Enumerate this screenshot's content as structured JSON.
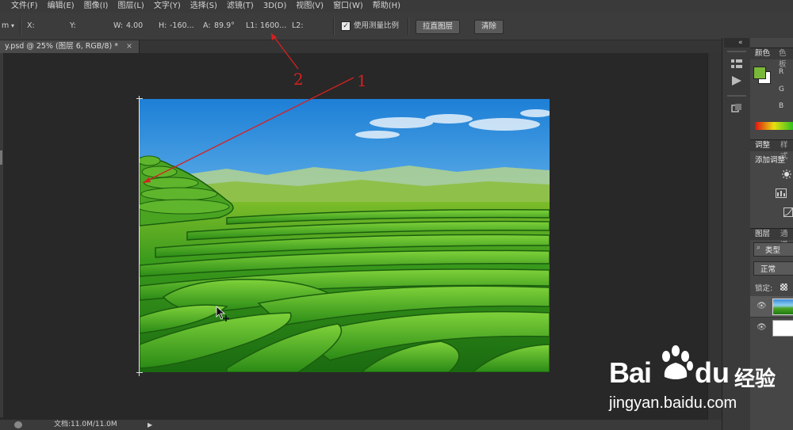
{
  "menu": [
    "文件(F)",
    "编辑(E)",
    "图像(I)",
    "图层(L)",
    "文字(Y)",
    "选择(S)",
    "滤镜(T)",
    "3D(D)",
    "视图(V)",
    "窗口(W)",
    "帮助(H)"
  ],
  "options": {
    "tool_icon": "ruler-tool-icon",
    "tool_glyph": "m",
    "dropdown_glyph": "▾",
    "x_label": "X:",
    "y_label": "Y:",
    "w_label": "W:",
    "w_value": "4.00",
    "h_label": "H:",
    "h_value": "-160...",
    "a_label": "A:",
    "a_value": "89.9°",
    "l1_label": "L1:",
    "l1_value": "1600...",
    "l2_label": "L2:",
    "checkbox_mark": "✓",
    "use_scale_label": "使用测量比例",
    "straighten_button": "拉直图层",
    "clear_button": "清除"
  },
  "document": {
    "tab_title": "y.psd @ 25% (图层 6, RGB/8) *",
    "close_glyph": "×"
  },
  "status": {
    "doc_info": "文档:11.0M/11.0M",
    "arrow": "▶"
  },
  "annotations": {
    "label_1": "1",
    "label_2": "2",
    "color": "#d62020"
  },
  "right_panel": {
    "collapse_glyph": "«",
    "color_tab": "颜色",
    "swatch_tab": "色板",
    "r": "R",
    "g": "G",
    "b": "B",
    "foreground_color": "#7ab83a",
    "background_color": "#ffffff",
    "adjust_tab": "调整",
    "style_tab": "样式",
    "add_adjust": "添加调整",
    "layers_tab": "图层",
    "channels_tab": "通道",
    "kind_filter": "类型",
    "blend_mode": "正常",
    "lock_label": "锁定:"
  },
  "watermark": {
    "brand_bai": "Bai",
    "brand_du": "du",
    "brand_cn": "经验",
    "url": "jingyan.baidu.com"
  }
}
